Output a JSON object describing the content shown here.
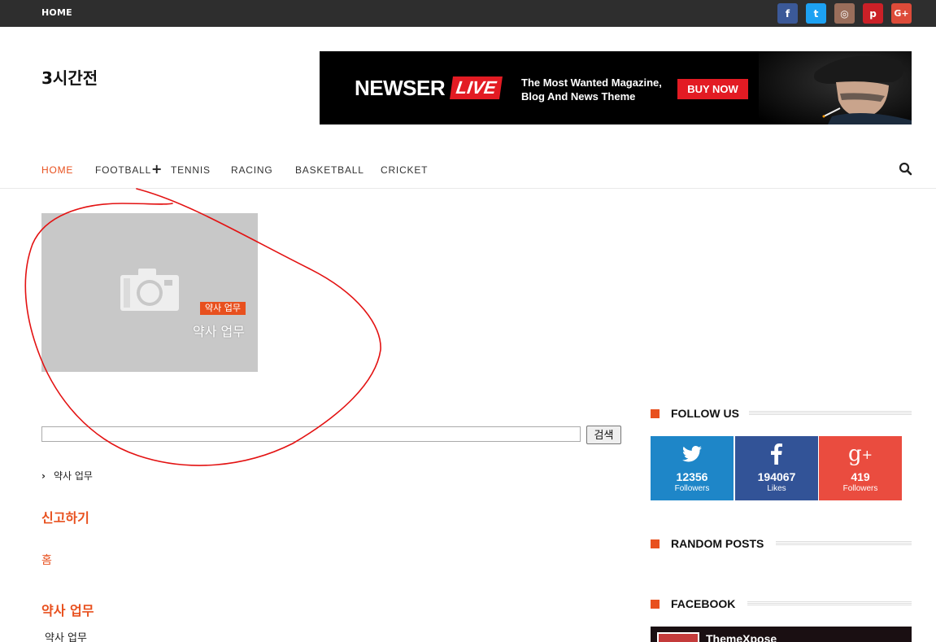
{
  "topbar": {
    "home": "HOME"
  },
  "social": [
    {
      "icon": "facebook-icon",
      "glyph": "f",
      "color": "#3b5998"
    },
    {
      "icon": "twitter-icon",
      "glyph": "t",
      "color": "#1da1f2"
    },
    {
      "icon": "instagram-icon",
      "glyph": "◎",
      "color": "#9a6e5b"
    },
    {
      "icon": "pinterest-icon",
      "glyph": "p",
      "color": "#cb2027"
    },
    {
      "icon": "google-plus-icon",
      "glyph": "G+",
      "color": "#dd4b39"
    }
  ],
  "header": {
    "site_title": "3시간전"
  },
  "banner": {
    "brand": "NEWSER",
    "live": "LIVE",
    "tagline_line1": "The Most Wanted Magazine,",
    "tagline_line2": "Blog And News Theme",
    "cta": "BUY NOW"
  },
  "nav": {
    "items": [
      "HOME",
      "FOOTBALL",
      "TENNIS",
      "RACING",
      "BASKETBALL",
      "CRICKET"
    ],
    "plus": "+"
  },
  "featured": {
    "category": "약사 업무",
    "title": "약사 업무"
  },
  "search": {
    "button": "검색",
    "value": ""
  },
  "left": {
    "list_item": "약사 업무",
    "report_heading": "신고하기",
    "home_link": "홈",
    "section_heading": "약사 업무",
    "section_item": "약사 업무"
  },
  "sidebar": {
    "follow_title": "FOLLOW US",
    "follow": [
      {
        "icon": "twitter-icon",
        "count": "12356",
        "label": "Followers",
        "color": "#1e86c8"
      },
      {
        "icon": "facebook-icon",
        "count": "194067",
        "label": "Likes",
        "color": "#325397"
      },
      {
        "icon": "google-plus-icon",
        "count": "419",
        "label": "Followers",
        "color": "#ea4c3f"
      }
    ],
    "random_title": "RANDOM POSTS",
    "facebook_title": "FACEBOOK",
    "fb_page_name": "ThemeXpose"
  }
}
